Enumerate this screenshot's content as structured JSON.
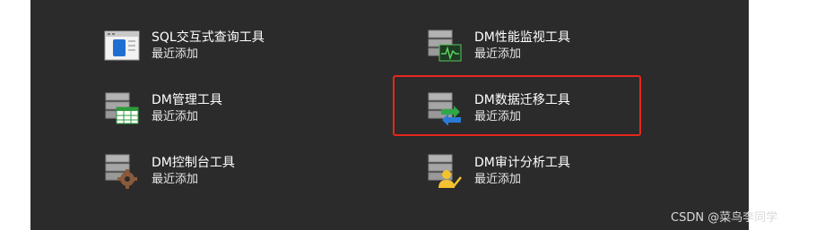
{
  "tools": [
    {
      "title": "SQL交互式查询工具",
      "subtitle": "最近添加",
      "icon": "sql-window-icon"
    },
    {
      "title": "DM性能监视工具",
      "subtitle": "最近添加",
      "icon": "performance-monitor-icon"
    },
    {
      "title": "DM管理工具",
      "subtitle": "最近添加",
      "icon": "manager-table-icon"
    },
    {
      "title": "DM数据迁移工具",
      "subtitle": "最近添加",
      "icon": "data-migration-icon"
    },
    {
      "title": "DM控制台工具",
      "subtitle": "最近添加",
      "icon": "console-gear-icon"
    },
    {
      "title": "DM审计分析工具",
      "subtitle": "最近添加",
      "icon": "audit-user-icon"
    }
  ],
  "watermark": "CSDN @菜鸟李同学",
  "colors": {
    "panel": "#2b2b2b",
    "highlight": "#e6271d"
  }
}
